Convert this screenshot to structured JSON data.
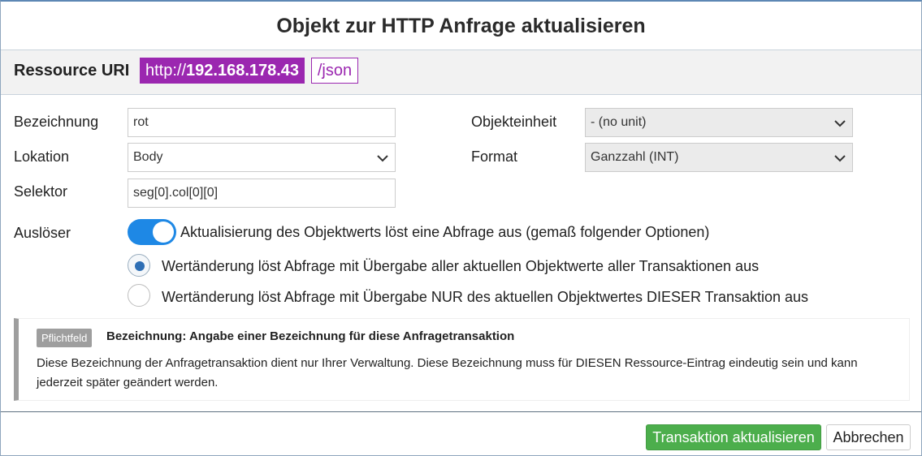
{
  "dialog": {
    "title": "Objekt zur HTTP Anfrage aktualisieren"
  },
  "uri": {
    "label": "Ressource URI",
    "scheme": "http://",
    "host": "192.168.178.43",
    "path": "/json"
  },
  "form": {
    "bezeichnung": {
      "label": "Bezeichnung",
      "value": "rot"
    },
    "lokation": {
      "label": "Lokation",
      "value": "Body"
    },
    "selektor": {
      "label": "Selektor",
      "value": "seg[0].col[0][0]"
    },
    "objekteinheit": {
      "label": "Objekteinheit",
      "value": "- (no unit)"
    },
    "format": {
      "label": "Format",
      "value": "Ganzzahl (INT)"
    }
  },
  "trigger": {
    "label": "Auslöser",
    "toggle_on": true,
    "toggle_text": "Aktualisierung des Objektwerts löst eine Abfrage aus (gemaß folgender Optionen)",
    "options": [
      {
        "text": "Wertänderung löst Abfrage mit Übergabe aller aktuellen Objektwerte aller Transaktionen aus",
        "checked": true
      },
      {
        "text": "Wertänderung löst Abfrage mit Übergabe NUR des aktuellen Objektwertes DIESER Transaktion aus",
        "checked": false
      }
    ]
  },
  "info": {
    "badge": "Pflichtfeld",
    "title": "Bezeichnung: Angabe einer Bezeichnung für diese Anfragetransaktion",
    "text": "Diese Bezeichnung der Anfragetransaktion dient nur Ihrer Verwaltung. Diese Bezeichnung muss für DIESEN Ressource-Eintrag eindeutig sein und kann jederzeit später geändert werden."
  },
  "buttons": {
    "update": "Transaktion aktualisieren",
    "cancel": "Abbrechen"
  },
  "colors": {
    "uri_accent": "#9b27b0",
    "toggle": "#1e88e5",
    "primary_button": "#4cae4c"
  }
}
